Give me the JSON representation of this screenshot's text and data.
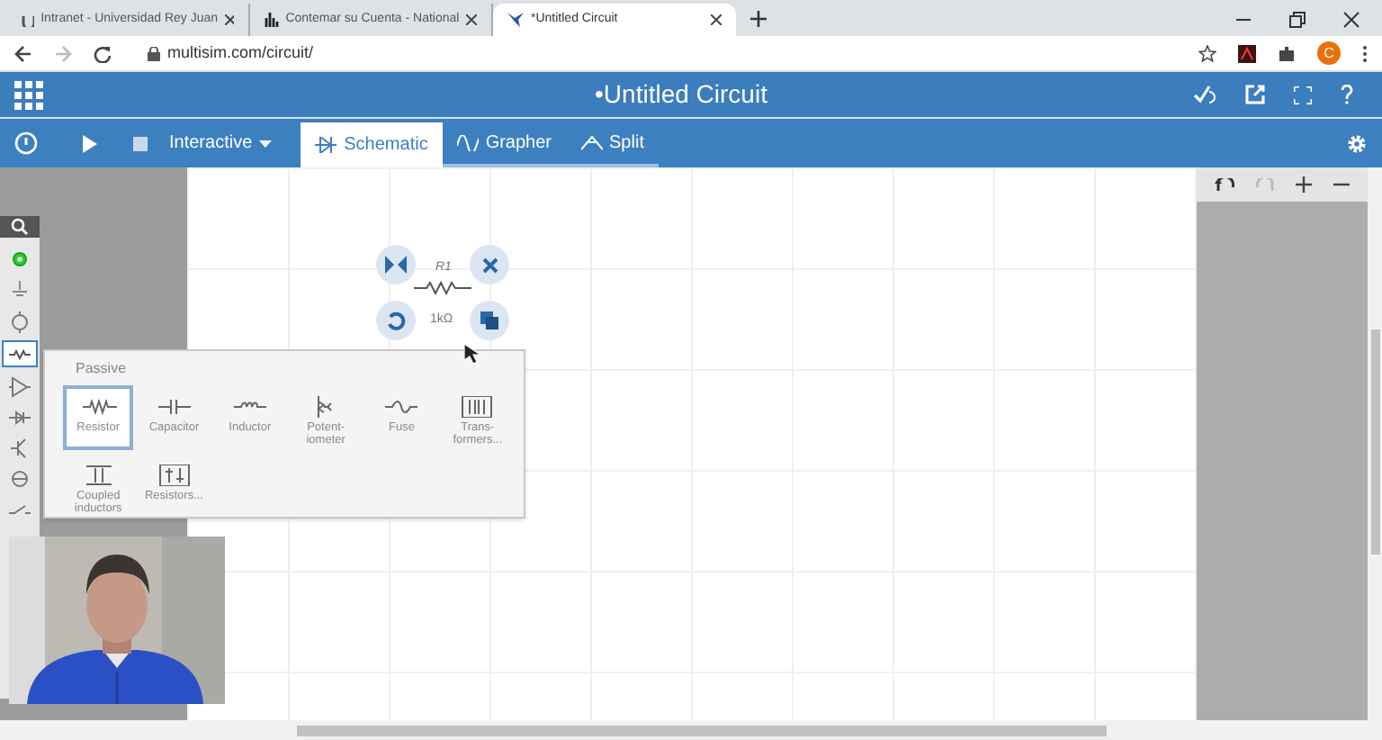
{
  "browser": {
    "tabs": [
      {
        "title": "Intranet - Universidad Rey Juan",
        "selected": false
      },
      {
        "title": "Contemar su Cuenta - National",
        "selected": false
      },
      {
        "title": "*Untitled Circuit",
        "selected": true
      }
    ],
    "url": "multisim.com/circuit/",
    "profile_initial": "C"
  },
  "app": {
    "title": "•Untitled Circuit",
    "toolbar": {
      "mode": "Interactive",
      "tabs": [
        {
          "label": "Schematic",
          "selected": true
        },
        {
          "label": "Grapher",
          "selected": false
        },
        {
          "label": "Split",
          "selected": false
        }
      ]
    },
    "component": {
      "ref": "R1",
      "value": "1kΩ"
    },
    "popup": {
      "title": "Passive",
      "items": [
        {
          "label": "Resistor",
          "selected": true
        },
        {
          "label": "Capacitor",
          "selected": false
        },
        {
          "label": "Inductor",
          "selected": false
        },
        {
          "label": "Potent-\niometer",
          "selected": false
        },
        {
          "label": "Fuse",
          "selected": false
        },
        {
          "label": "Trans-\nformers...",
          "selected": false
        },
        {
          "label": "Coupled\ninductors",
          "selected": false
        },
        {
          "label": "Resistors...",
          "selected": false
        }
      ]
    }
  }
}
